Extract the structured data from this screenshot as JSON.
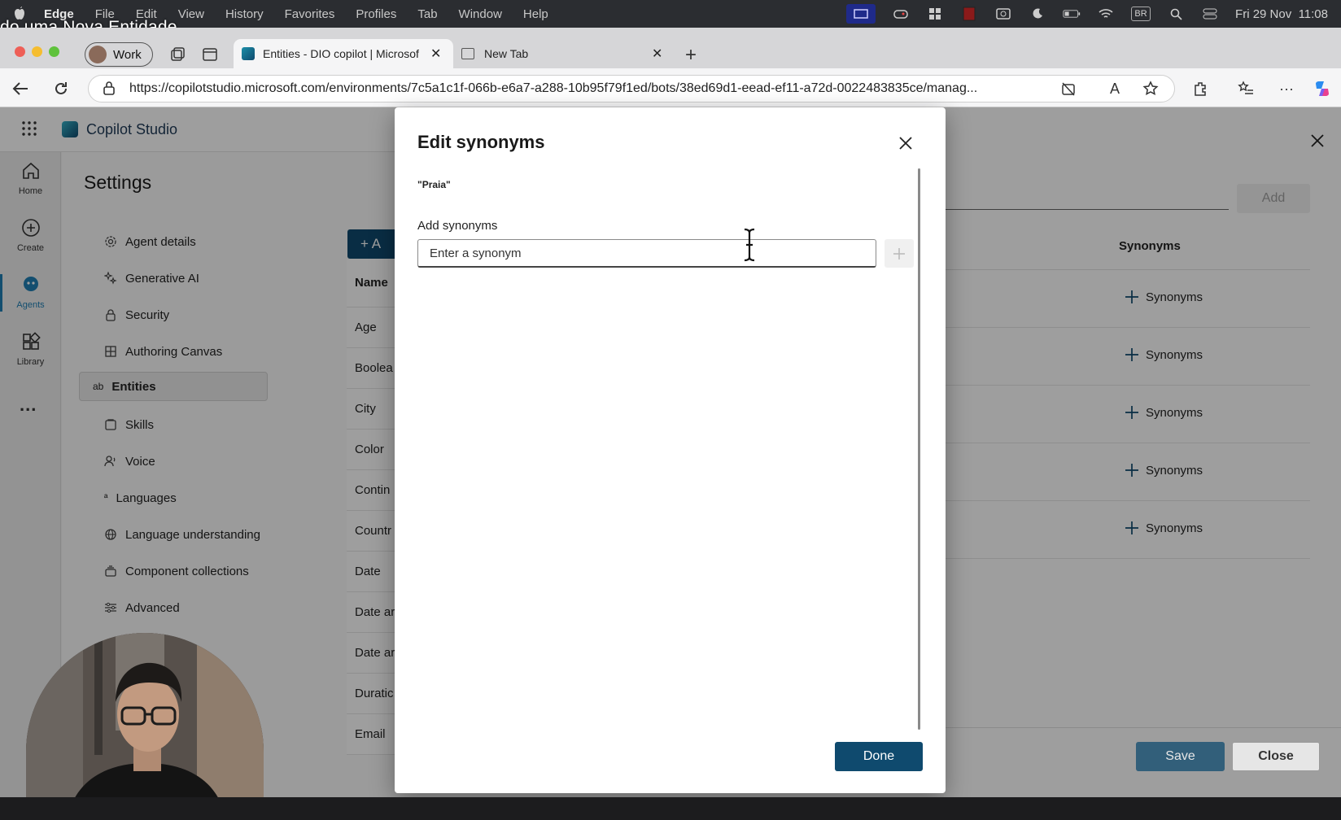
{
  "os_menubar": {
    "app_name": "Edge",
    "menu_items": [
      "File",
      "Edit",
      "View",
      "History",
      "Favorites",
      "Profiles",
      "Tab",
      "Window",
      "Help"
    ],
    "clock": "Fri 29 Nov  11:08",
    "tray_badge": "BR"
  },
  "caption_overlay": "do uma Nova Entidade",
  "browser": {
    "profile_label": "Work",
    "tabs": [
      {
        "title": "Entities - DIO copilot | Microsof",
        "active": true
      },
      {
        "title": "New Tab",
        "active": false
      }
    ],
    "url": "https://copilotstudio.microsoft.com/environments/7c5a1c1f-066b-e6a7-a288-10b95f79f1ed/bots/38ed69d1-eead-ef11-a72d-0022483835ce/manag..."
  },
  "app": {
    "brand": "Copilot Studio",
    "rail": [
      {
        "label": "Home",
        "icon": "home-icon"
      },
      {
        "label": "Create",
        "icon": "plus-circle-icon"
      },
      {
        "label": "Agents",
        "icon": "agents-icon"
      },
      {
        "label": "Library",
        "icon": "library-icon"
      }
    ],
    "rail_more": "...",
    "settings_title": "Settings",
    "settings_items": [
      {
        "label": "Agent details",
        "icon": "gear-icon"
      },
      {
        "label": "Generative AI",
        "icon": "sparkle-icon"
      },
      {
        "label": "Security",
        "icon": "lock-icon"
      },
      {
        "label": "Authoring Canvas",
        "icon": "grid-icon"
      },
      {
        "label": "Entities",
        "icon": "ab-icon",
        "selected": true
      },
      {
        "label": "Skills",
        "icon": "skills-icon"
      },
      {
        "label": "Voice",
        "icon": "voice-icon"
      },
      {
        "label": "Languages",
        "icon": "languages-icon"
      },
      {
        "label": "Language understanding",
        "icon": "globe-icon"
      },
      {
        "label": "Component collections",
        "icon": "collection-icon"
      },
      {
        "label": "Advanced",
        "icon": "sliders-icon"
      }
    ],
    "add_button": "+ A",
    "grid_header": "Name",
    "grid_rows": [
      "Age",
      "Boolea",
      "City",
      "Color",
      "Contin",
      "Countr",
      "Date",
      "Date ar",
      "Date ar",
      "Duratic",
      "Email"
    ]
  },
  "right_panel": {
    "add_label": "Add",
    "column_header": "Synonyms",
    "rows": [
      "Synonyms",
      "Synonyms",
      "Synonyms",
      "Synonyms",
      "Synonyms"
    ],
    "save_label": "Save",
    "close_label": "Close"
  },
  "dialog": {
    "title": "Edit synonyms",
    "value_quote": "\"Praia\"",
    "add_label": "Add synonyms",
    "input_placeholder": "Enter a synonym",
    "done_label": "Done"
  },
  "colors": {
    "primary": "#0f4a6e",
    "menubar": "#2b2d31"
  }
}
